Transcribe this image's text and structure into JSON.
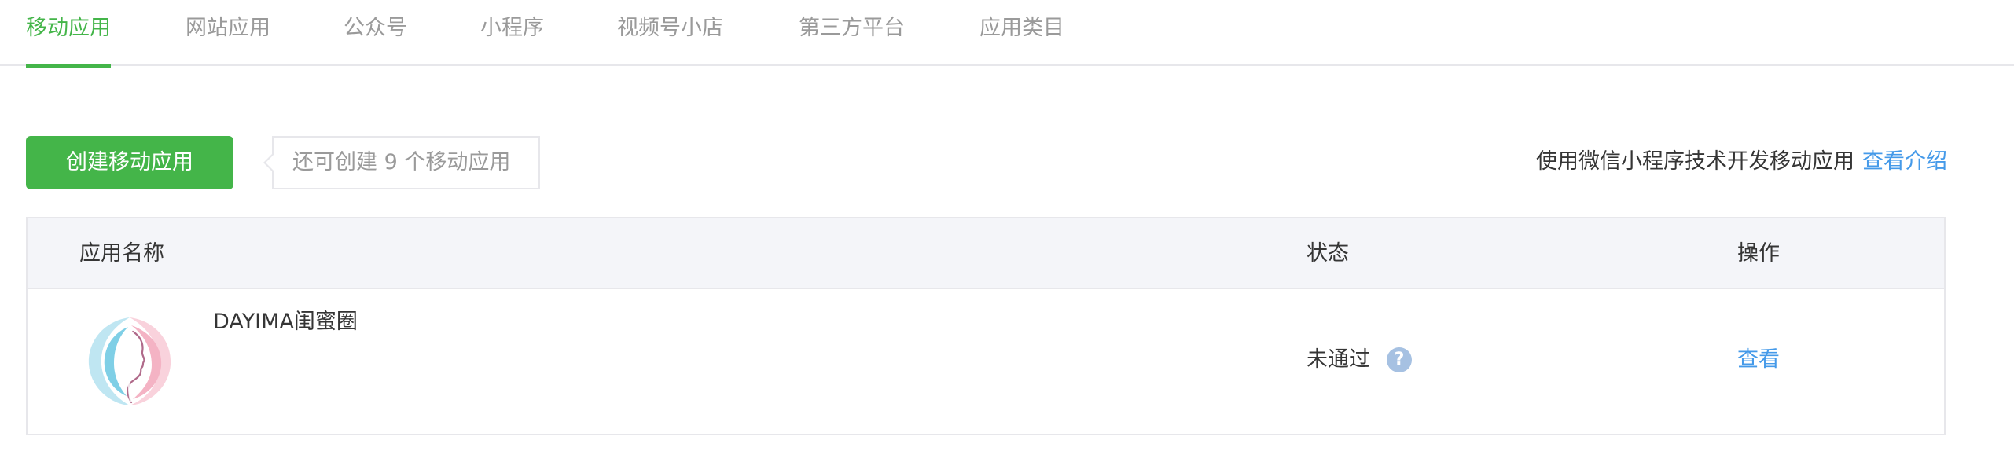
{
  "tabs": [
    {
      "label": "移动应用",
      "active": true
    },
    {
      "label": "网站应用",
      "active": false
    },
    {
      "label": "公众号",
      "active": false
    },
    {
      "label": "小程序",
      "active": false
    },
    {
      "label": "视频号小店",
      "active": false
    },
    {
      "label": "第三方平台",
      "active": false
    },
    {
      "label": "应用类目",
      "active": false
    }
  ],
  "toolbar": {
    "create_label": "创建移动应用",
    "quota_text": "还可创建 9 个移动应用",
    "promo_text": "使用微信小程序技术开发移动应用",
    "promo_link": "查看介绍"
  },
  "table": {
    "headers": {
      "name": "应用名称",
      "status": "状态",
      "action": "操作"
    },
    "rows": [
      {
        "name": "DAYIMA闺蜜圈",
        "status": "未通过",
        "help_icon": "question-icon",
        "action": "查看"
      }
    ]
  },
  "colors": {
    "accent": "#44b549",
    "link": "#459ae9",
    "header_bg": "#f4f5f9",
    "border": "#e7e7eb",
    "help_icon": "#a6c1e2"
  }
}
